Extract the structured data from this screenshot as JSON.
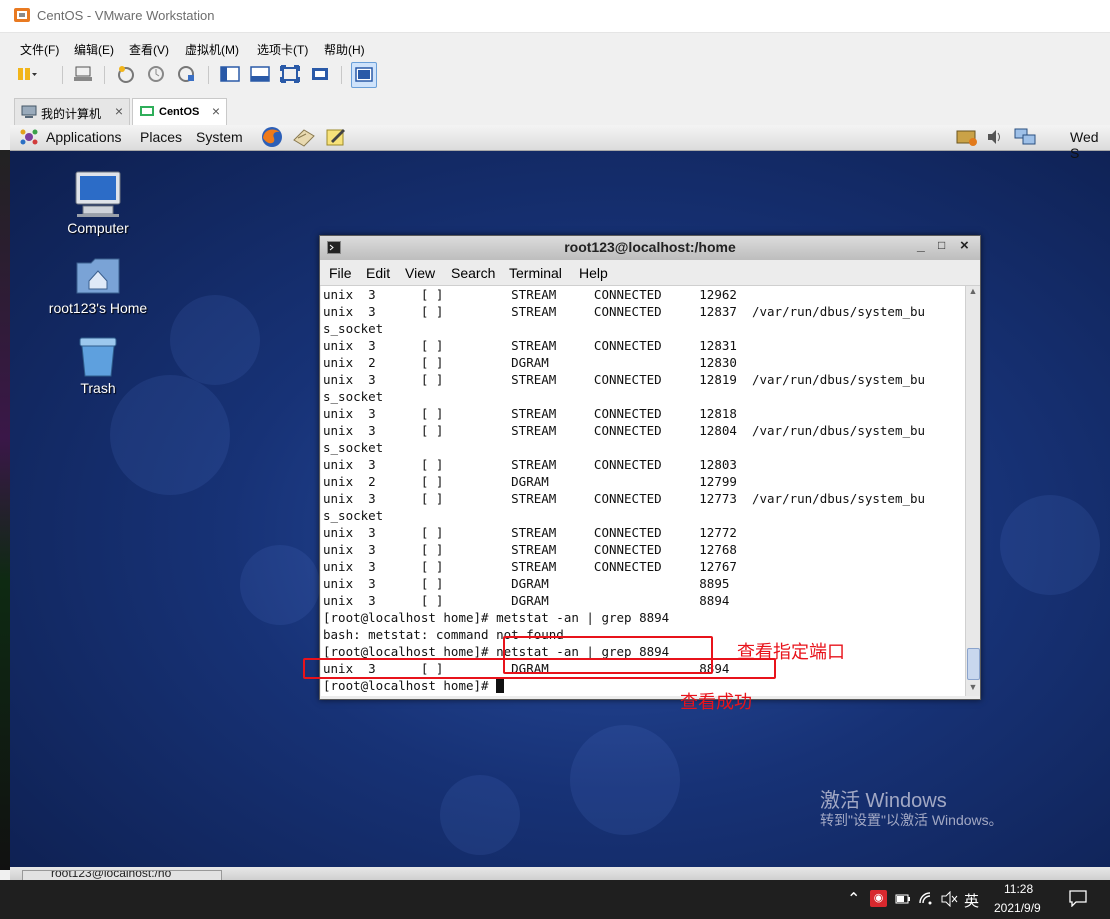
{
  "vmware": {
    "title": "CentOS - VMware Workstation",
    "menu": [
      "文件(F)",
      "编辑(E)",
      "查看(V)",
      "虚拟机(M)",
      "选项卡(T)",
      "帮助(H)"
    ],
    "tabs": [
      {
        "label": "我的计算机",
        "active": false
      },
      {
        "label": "CentOS",
        "active": true
      }
    ]
  },
  "gnome_panel": {
    "menus": [
      "Applications",
      "Places",
      "System"
    ],
    "clock": "Wed S"
  },
  "desktop_icons": [
    {
      "label": "Computer",
      "icon": "computer-icon"
    },
    {
      "label": "root123's Home",
      "icon": "home-folder-icon"
    },
    {
      "label": "Trash",
      "icon": "trash-icon"
    }
  ],
  "terminal": {
    "title": "root123@localhost:/home",
    "menu": [
      "File",
      "Edit",
      "View",
      "Search",
      "Terminal",
      "Help"
    ],
    "lines": [
      "unix  3      [ ]         STREAM     CONNECTED     12962",
      "unix  3      [ ]         STREAM     CONNECTED     12837  /var/run/dbus/system_bu",
      "s_socket",
      "unix  3      [ ]         STREAM     CONNECTED     12831",
      "unix  2      [ ]         DGRAM                    12830",
      "unix  3      [ ]         STREAM     CONNECTED     12819  /var/run/dbus/system_bu",
      "s_socket",
      "unix  3      [ ]         STREAM     CONNECTED     12818",
      "unix  3      [ ]         STREAM     CONNECTED     12804  /var/run/dbus/system_bu",
      "s_socket",
      "unix  3      [ ]         STREAM     CONNECTED     12803",
      "unix  2      [ ]         DGRAM                    12799",
      "unix  3      [ ]         STREAM     CONNECTED     12773  /var/run/dbus/system_bu",
      "s_socket",
      "unix  3      [ ]         STREAM     CONNECTED     12772",
      "unix  3      [ ]         STREAM     CONNECTED     12768",
      "unix  3      [ ]         STREAM     CONNECTED     12767",
      "unix  3      [ ]         DGRAM                    8895",
      "unix  3      [ ]         DGRAM                    8894",
      "[root@localhost home]# metstat -an | grep 8894",
      "bash: metstat: command not found",
      "[root@localhost home]# netstat -an | grep 8894",
      "unix  3      [ ]         DGRAM                    8894",
      "[root@localhost home]# "
    ]
  },
  "annotations": {
    "port_label": "查看指定端口",
    "success_label": "查看成功"
  },
  "watermark": {
    "line1": "激活 Windows",
    "line2": "转到\"设置\"以激活 Windows。"
  },
  "guest_taskbar": {
    "item": "root123@localhost:/ho"
  },
  "host_taskbar": {
    "ime": "英",
    "time": "11:28",
    "date": "2021/9/9"
  }
}
